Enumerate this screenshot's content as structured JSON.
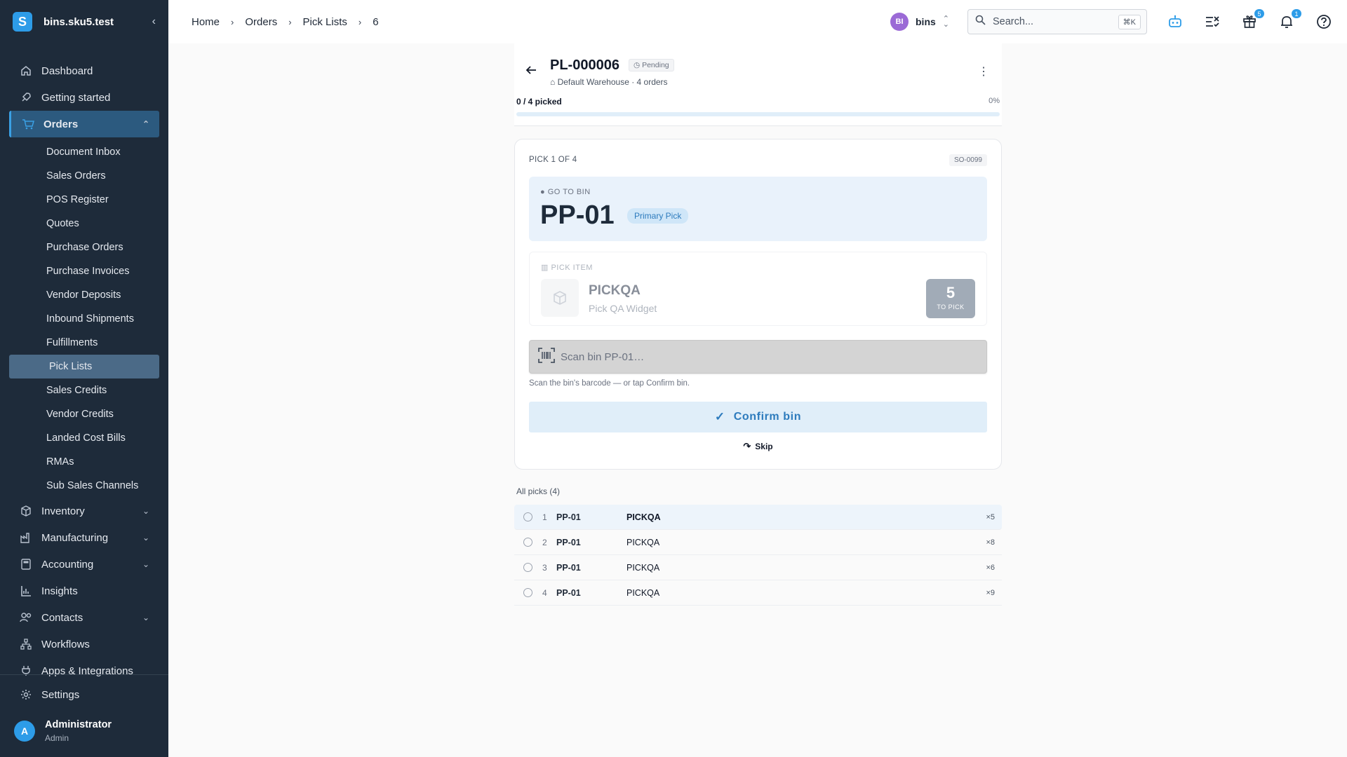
{
  "sidebar": {
    "org_name": "bins.sku5.test",
    "logo_letter": "S",
    "collapse_glyph": "‹",
    "items": [
      {
        "label": "Dashboard",
        "icon": "home-icon"
      },
      {
        "label": "Getting started",
        "icon": "rocket-icon"
      },
      {
        "label": "Orders",
        "icon": "cart-icon",
        "expanded": true
      },
      {
        "label": "Inventory",
        "icon": "box-icon"
      },
      {
        "label": "Manufacturing",
        "icon": "factory-icon"
      },
      {
        "label": "Accounting",
        "icon": "calculator-icon"
      },
      {
        "label": "Insights",
        "icon": "chart-icon"
      },
      {
        "label": "Contacts",
        "icon": "people-icon"
      },
      {
        "label": "Workflows",
        "icon": "workflow-icon"
      },
      {
        "label": "Apps & Integrations",
        "icon": "plug-icon"
      }
    ],
    "orders_sub": [
      "Document Inbox",
      "Sales Orders",
      "POS Register",
      "Quotes",
      "Purchase Orders",
      "Purchase Invoices",
      "Vendor Deposits",
      "Inbound Shipments",
      "Fulfillments",
      "Pick Lists",
      "Sales Credits",
      "Vendor Credits",
      "Landed Cost Bills",
      "RMAs",
      "Sub Sales Channels"
    ],
    "active_sub": "Pick Lists",
    "settings_label": "Settings",
    "user": {
      "initial": "A",
      "name": "Administrator",
      "role": "Admin"
    }
  },
  "topbar": {
    "breadcrumbs": [
      "Home",
      "Orders",
      "Pick Lists",
      "6"
    ],
    "org": {
      "initials": "BI",
      "name": "bins"
    },
    "search": {
      "placeholder": "Search...",
      "shortcut": "⌘K"
    },
    "gift_badge": "5",
    "bell_badge": "1"
  },
  "pick_list": {
    "id": "PL-000006",
    "status": "Pending",
    "warehouse": "Default Warehouse · 4 orders",
    "progress_label": "0 / 4 picked",
    "progress_pct": "0%",
    "progress_fraction": 0
  },
  "current_pick": {
    "position": "PICK 1 OF 4",
    "order_ref": "SO-0099",
    "goto_label": "GO TO BIN",
    "bin": "PP-01",
    "bin_type": "Primary Pick",
    "item_label": "PICK ITEM",
    "sku": "PICKQA",
    "name": "Pick QA Widget",
    "qty": "5",
    "qty_label": "TO PICK",
    "scan_placeholder": "Scan bin PP-01…",
    "scan_help": "Scan the bin's barcode — or tap Confirm bin.",
    "confirm_label": "Confirm bin",
    "skip_label": "Skip"
  },
  "all_picks": {
    "title": "All picks (4)",
    "rows": [
      {
        "n": "1",
        "bin": "PP-01",
        "sku": "PICKQA",
        "qty": "×5"
      },
      {
        "n": "2",
        "bin": "PP-01",
        "sku": "PICKQA",
        "qty": "×8"
      },
      {
        "n": "3",
        "bin": "PP-01",
        "sku": "PICKQA",
        "qty": "×6"
      },
      {
        "n": "4",
        "bin": "PP-01",
        "sku": "PICKQA",
        "qty": "×9"
      }
    ]
  }
}
